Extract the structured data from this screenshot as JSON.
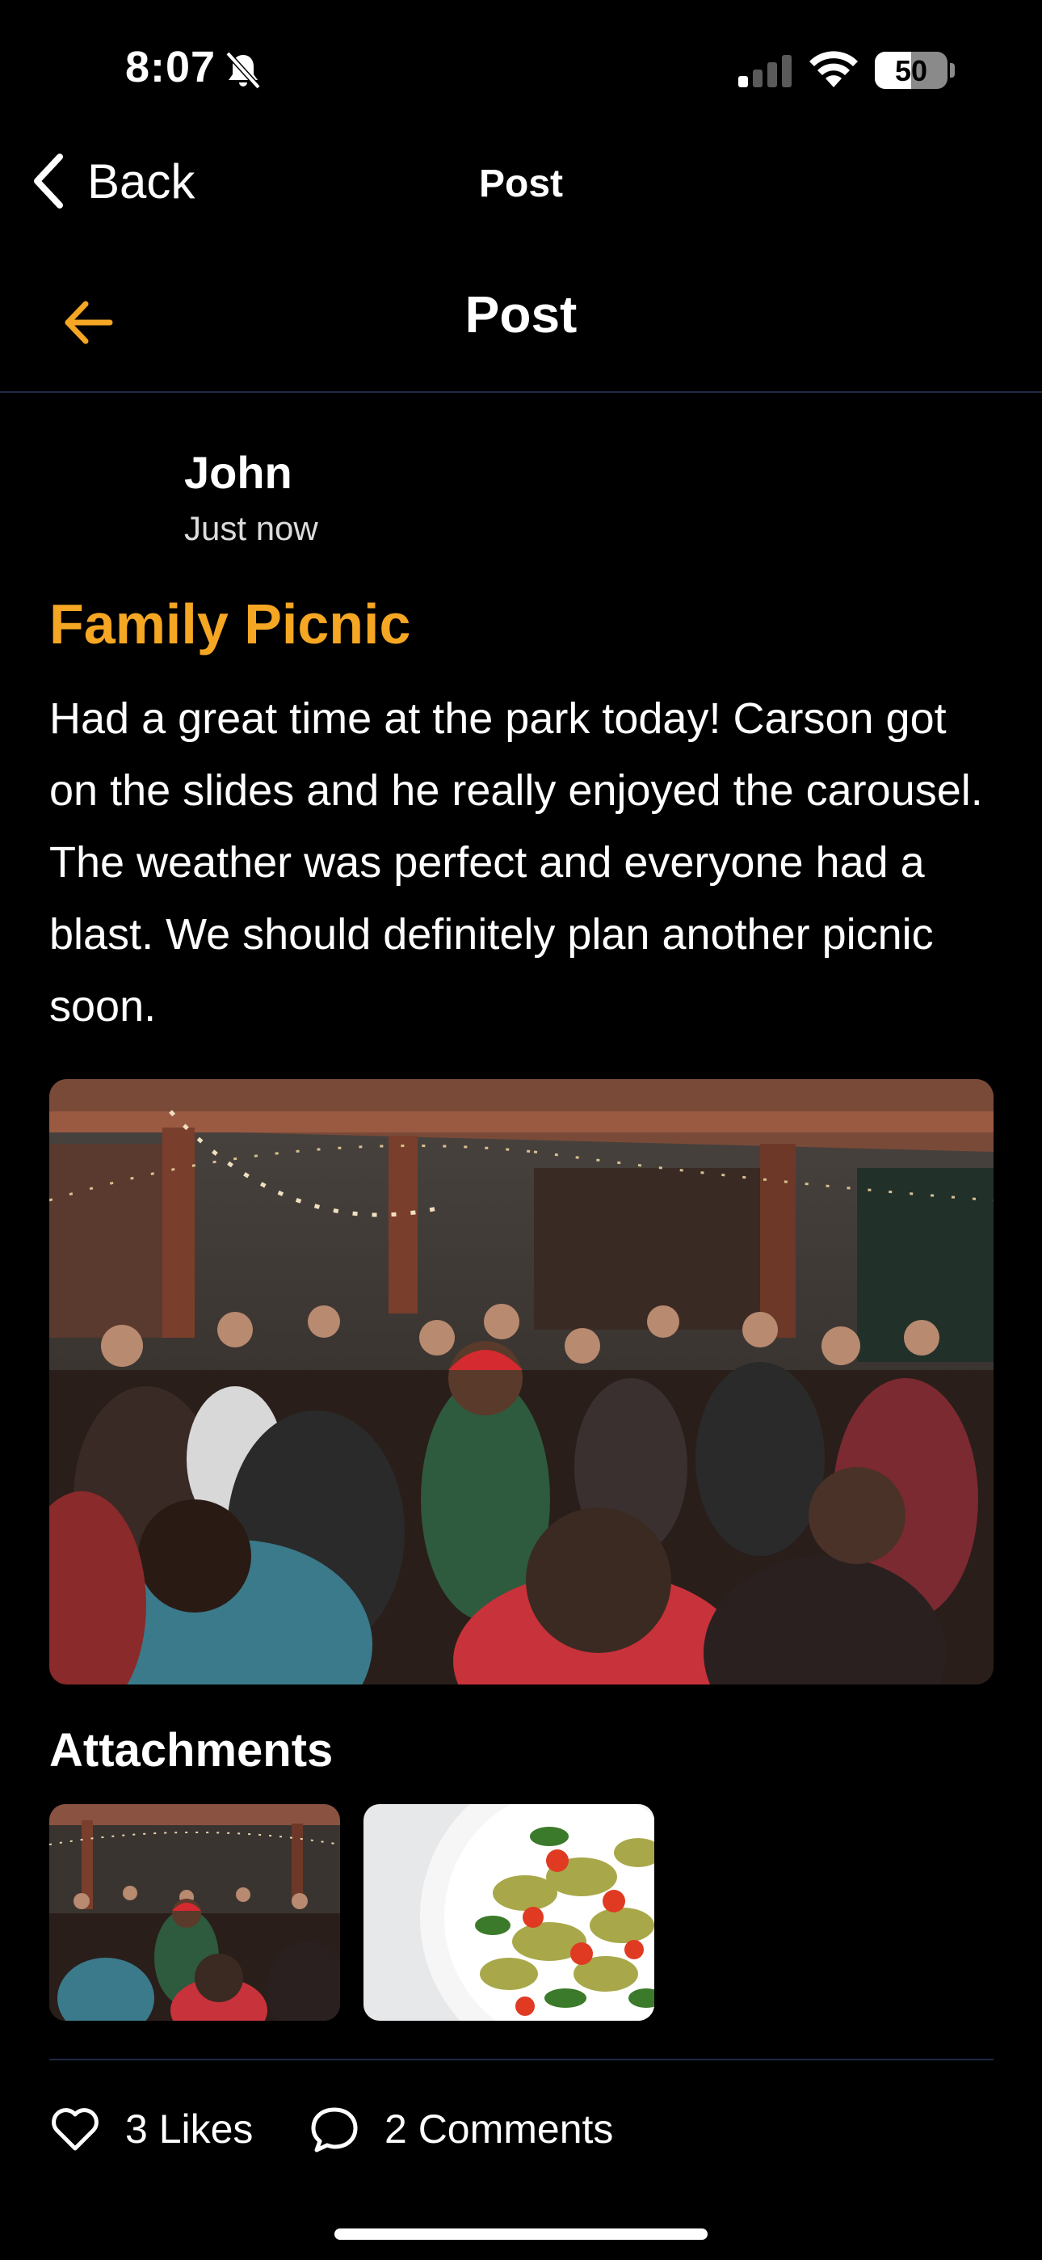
{
  "status_bar": {
    "time": "8:07",
    "battery_level": "50",
    "battery_fraction": 0.5,
    "icons": [
      "bell-slash-icon",
      "cellular-signal-icon",
      "wifi-icon",
      "battery-icon"
    ]
  },
  "system_nav": {
    "back_label": "Back",
    "title": "Post"
  },
  "header": {
    "title": "Post",
    "back_icon": "arrow-left-icon",
    "accent_color": "#f5a623"
  },
  "post": {
    "author": "John",
    "timestamp": "Just now",
    "title": "Family Picnic",
    "body": "Had a great time at the park today! Carson got on the slides and he really enjoyed the carousel. The weather was perfect and everyone had a blast. We should definitely plan another picnic soon."
  },
  "attachments": {
    "title": "Attachments",
    "items": [
      {
        "kind": "crowd-photo"
      },
      {
        "kind": "pasta-salad-photo"
      }
    ]
  },
  "actions": {
    "likes_label": "3 Likes",
    "comments_label": "2 Comments",
    "likes_icon": "heart-icon",
    "comments_icon": "comment-bubble-icon"
  }
}
